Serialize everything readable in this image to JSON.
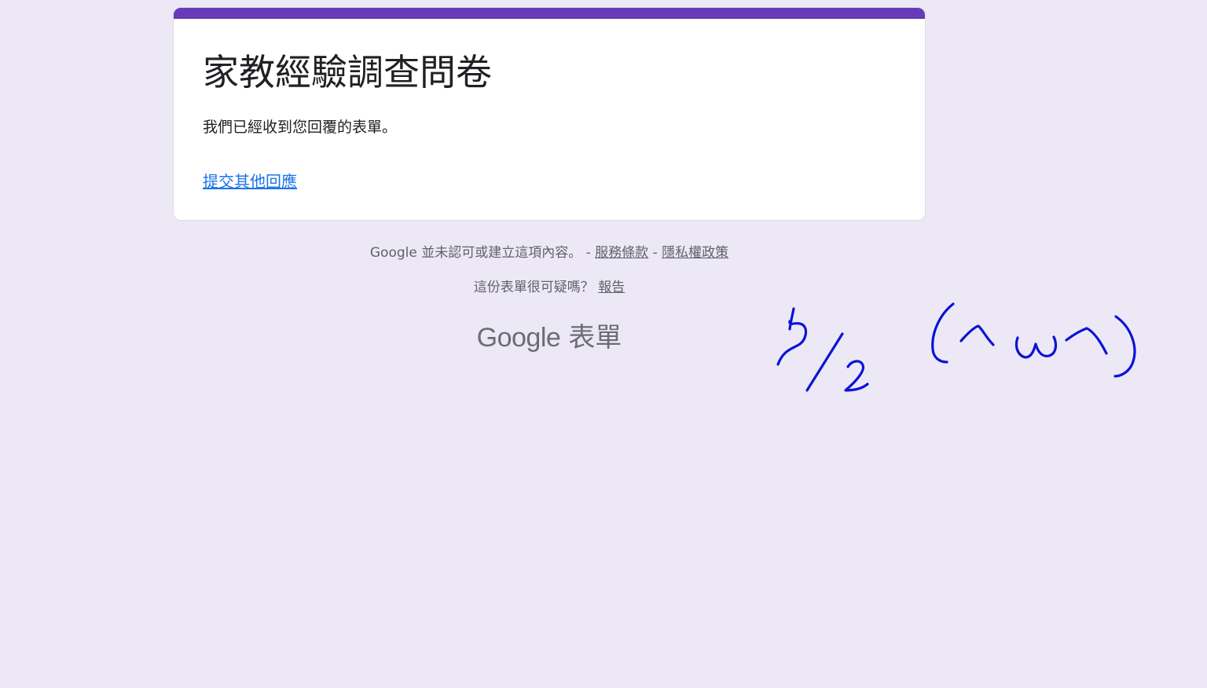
{
  "form": {
    "title": "家教經驗調查問卷",
    "confirmation_message": "我們已經收到您回覆的表單。",
    "submit_another_label": "提交其他回應"
  },
  "footer": {
    "disclaimer": "Google 並未認可或建立這項內容。 - ",
    "terms_label": "服務條款",
    "separator": " - ",
    "privacy_label": "隱私權政策",
    "report_prompt": "這份表單很可疑嗎？ ",
    "report_label": "報告"
  },
  "brand": {
    "google": "Google",
    "product": "表單"
  },
  "annotation": {
    "handwritten_text": "5/2 (^w^)"
  },
  "colors": {
    "background": "#ede8f6",
    "accent": "#673ab7",
    "link": "#1a73e8",
    "footer_text": "#5f6368",
    "ink": "#0a14d6"
  }
}
